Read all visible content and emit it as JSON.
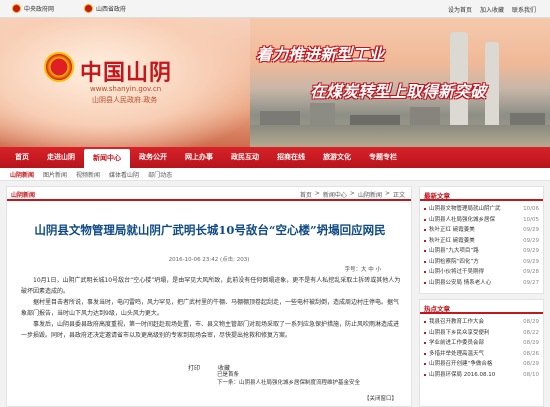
{
  "topbar": {
    "left1": "中央政府网",
    "left2": "山西省政府",
    "links": [
      "设为首页",
      "加入收藏",
      "联系我们"
    ]
  },
  "banner": {
    "site_name": "中国山阴",
    "url": "www.shanyin.gov.cn",
    "subtitle": "山阴县人民政府.政务",
    "slogan_line1": "着力推进新型工业",
    "slogan_line2": "在煤炭转型上取得新突破"
  },
  "nav": {
    "items": [
      "首页",
      "走进山阴",
      "新闻中心",
      "政务公开",
      "网上办事",
      "政民互动",
      "招商在线",
      "旅游文化",
      "专题专栏"
    ],
    "active_index": 2
  },
  "subnav": {
    "items": [
      "山阴新闻",
      "图片新闻",
      "视频新闻",
      "媒体看山阴",
      "部门动态"
    ],
    "current_index": 0
  },
  "article": {
    "section_tab": "山阴新闻",
    "breadcrumb": [
      "首页",
      ">",
      "新闻中心",
      ">",
      "山阴新闻",
      ">",
      "正文"
    ],
    "title": "山阴县文物管理局就山阴广武明长城10号敌台“空心楼”坍塌回应网民",
    "meta": "2016-10-06 23:42    (点击: 203)",
    "fontsize_label": "字号：大  中  小",
    "paragraphs": [
      "10月1日，山阴广武明长城10号敌台“空心楼”坍塌，是由罕见大风所致，此前没有任何倒塌迹象，更不是有人私挖乱采取土拆砖或其他人为破坏因素造成的。",
      "据村里目击者所说，事发当时，电闪雷鸣，风力罕见，把广武村里的牛棚、马棚棚顶卷起刮走，一些电杆被刮倒，造成周边村庄停电。据气象部门报告，当时山下风力达到9级，山头风力更大。",
      "事发后，山阴县委县政府高度重视，第一时间赶赴现场处置，市、县文物主管部门对现场采取了一系列应急保护措施，防止风吹雨淋造成进一步损毁。同时，县政府还决定邀请省市以及更高级别的专家到现场会审，尽快提出抢救和修复方案。"
    ],
    "print_label": "打印",
    "favorite_label": "收藏",
    "prev_label": "已是首条",
    "next_label": "下一条：山阴县人社局强化城乡居保制度流程维护基金安全",
    "close_label": "【关闭窗口】"
  },
  "sidebar": {
    "latest": {
      "title": "最新文章",
      "items": [
        {
          "text": "山阴县文物管理局就山阴广武",
          "date": "10/06"
        },
        {
          "text": "山阴县人社局强化城乡居保",
          "date": "10/05"
        },
        {
          "text": "秋叶正红  碗霞姜美",
          "date": "09/29"
        },
        {
          "text": "秋叶正红  碗霞姜美",
          "date": "09/29"
        },
        {
          "text": "山阴县“九大项目”路",
          "date": "09/29"
        },
        {
          "text": "山阴检察院“四化”方",
          "date": "09/29"
        },
        {
          "text": "山阴小伙将过干吴刚得",
          "date": "09/28"
        },
        {
          "text": "山阴县公安局  情系老人心",
          "date": "09/27"
        }
      ]
    },
    "hot": {
      "title": "热点文章",
      "items": [
        {
          "text": "我县召开教育工作大会",
          "date": "08/29"
        },
        {
          "text": "山阴县下乡民众享受便利",
          "date": "08/22"
        },
        {
          "text": "学业前进工作委员会部",
          "date": "08/29"
        },
        {
          "text": "多措并举处理高温天气",
          "date": "08/26"
        },
        {
          "text": "山阴县召开创建“争做合格",
          "date": "08/29"
        },
        {
          "text": "山阴县环保局  2016.08.10",
          "date": "08/10"
        }
      ]
    }
  }
}
